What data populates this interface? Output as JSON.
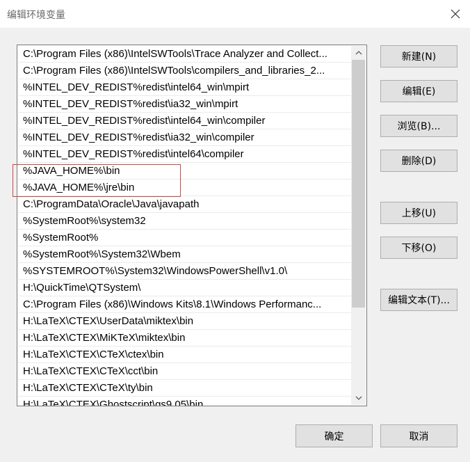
{
  "window": {
    "title": "编辑环境变量"
  },
  "path_list": {
    "items": [
      "C:\\Program Files (x86)\\IntelSWTools\\Trace Analyzer and Collect...",
      "C:\\Program Files (x86)\\IntelSWTools\\compilers_and_libraries_2...",
      "%INTEL_DEV_REDIST%redist\\intel64_win\\mpirt",
      "%INTEL_DEV_REDIST%redist\\ia32_win\\mpirt",
      "%INTEL_DEV_REDIST%redist\\intel64_win\\compiler",
      "%INTEL_DEV_REDIST%redist\\ia32_win\\compiler",
      "%INTEL_DEV_REDIST%redist\\intel64\\compiler",
      "%JAVA_HOME%\\bin",
      "%JAVA_HOME%\\jre\\bin",
      "C:\\ProgramData\\Oracle\\Java\\javapath",
      "%SystemRoot%\\system32",
      "%SystemRoot%",
      "%SystemRoot%\\System32\\Wbem",
      "%SYSTEMROOT%\\System32\\WindowsPowerShell\\v1.0\\",
      "H:\\QuickTime\\QTSystem\\",
      "C:\\Program Files (x86)\\Windows Kits\\8.1\\Windows Performanc...",
      "H:\\LaTeX\\CTEX\\UserData\\miktex\\bin",
      "H:\\LaTeX\\CTEX\\MiKTeX\\miktex\\bin",
      "H:\\LaTeX\\CTEX\\CTeX\\ctex\\bin",
      "H:\\LaTeX\\CTEX\\CTeX\\cct\\bin",
      "H:\\LaTeX\\CTEX\\CTeX\\ty\\bin",
      "H:\\LaTeX\\CTEX\\Ghostscript\\gs9.05\\bin"
    ],
    "highlighted_items": [
      7,
      8
    ]
  },
  "buttons": {
    "new": "新建(N)",
    "edit": "编辑(E)",
    "browse": "浏览(B)...",
    "delete": "删除(D)",
    "move_up": "上移(U)",
    "move_down": "下移(O)",
    "edit_text": "编辑文本(T)...",
    "ok": "确定",
    "cancel": "取消"
  },
  "colors": {
    "highlight_border": "#d84040",
    "dialog_background": "#f0f0f0",
    "button_background": "#e1e1e1"
  },
  "icons": {
    "close": "close-icon",
    "scroll_up": "chevron-up-icon",
    "scroll_down": "chevron-down-icon"
  }
}
